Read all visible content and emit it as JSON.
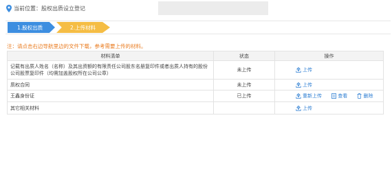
{
  "location": {
    "label": "当前位置：股权出质设立登记"
  },
  "steps": [
    {
      "label": "1.股权出质"
    },
    {
      "label": "2.上传材料"
    }
  ],
  "notice": "注：请点击右边导航里边的文件下载，参考需要上传的材料。",
  "table": {
    "headers": [
      "材料清单",
      "状态",
      "操作"
    ],
    "rows": [
      {
        "name": "记载有出质人姓名（名称）及其出资额的有限责任公司股东名册复印件或者出质人持有的股份公司股票复印件（均需加盖股权所在公司公章）",
        "status": "未上传",
        "actions": [
          "上传"
        ]
      },
      {
        "name": "质权合同",
        "status": "未上传",
        "actions": [
          "上传"
        ]
      },
      {
        "name": "王鑫身份证",
        "status": "已上传",
        "actions": [
          "重新上传",
          "查看",
          "删除"
        ]
      },
      {
        "name": "其它相关材料",
        "status": "",
        "actions": [
          "上传"
        ]
      }
    ]
  },
  "colors": {
    "step_active": "#3d8ee0",
    "step_current": "#f5bd45",
    "notice": "#e97b1f",
    "link": "#2f7fd3"
  }
}
